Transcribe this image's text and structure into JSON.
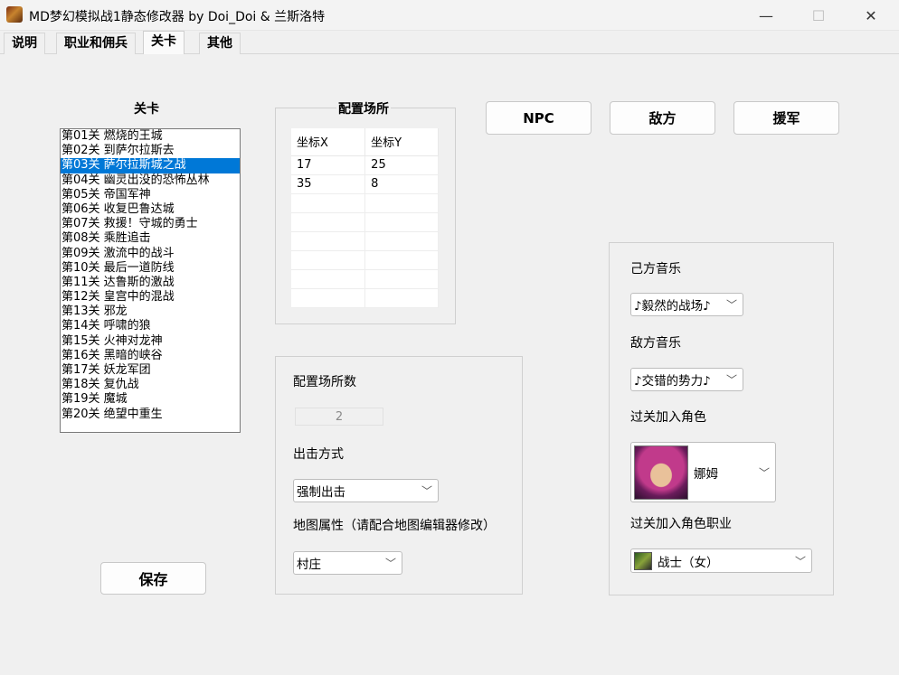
{
  "window": {
    "title": "MD梦幻模拟战1静态修改器 by Doi_Doi & 兰斯洛特",
    "icon": "game-character-icon",
    "controls": {
      "minimize": "—",
      "maximize": "☐",
      "close": "✕"
    }
  },
  "tabs": [
    {
      "label": "说明",
      "active": false
    },
    {
      "label": "职业和佣兵",
      "active": false
    },
    {
      "label": "关卡",
      "active": true
    },
    {
      "label": "其他",
      "active": false
    }
  ],
  "levels": {
    "heading": "关卡",
    "selected_index": 2,
    "items": [
      "第01关 燃烧的王城",
      "第02关 到萨尔拉斯去",
      "第03关 萨尔拉斯城之战",
      "第04关 幽灵出没的恐怖丛林",
      "第05关 帝国军神",
      "第06关 收复巴鲁达城",
      "第07关 救援！守城的勇士",
      "第08关 乘胜追击",
      "第09关 激流中的战斗",
      "第10关 最后一道防线",
      "第11关 达鲁斯的激战",
      "第12关 皇宫中的混战",
      "第13关 邪龙",
      "第14关 呼啸的狼",
      "第15关 火神对龙神",
      "第16关 黑暗的峡谷",
      "第17关 妖龙军团",
      "第18关 复仇战",
      "第19关 魔城",
      "第20关 绝望中重生"
    ]
  },
  "placement": {
    "heading": "配置场所",
    "columns": [
      "坐标X",
      "坐标Y"
    ],
    "rows": [
      [
        "17",
        "25"
      ],
      [
        "35",
        "8"
      ],
      [
        "",
        ""
      ],
      [
        "",
        ""
      ],
      [
        "",
        ""
      ],
      [
        "",
        ""
      ],
      [
        "",
        ""
      ],
      [
        "",
        ""
      ]
    ]
  },
  "buttons": {
    "npc": "NPC",
    "enemy": "敌方",
    "reinforce": "援军",
    "save": "保存"
  },
  "settings": {
    "count_label": "配置场所数",
    "count_value": "2",
    "sortie_label": "出击方式",
    "sortie_value": "强制出击",
    "map_attr_label": "地图属性（请配合地图编辑器修改）",
    "map_attr_value": "村庄"
  },
  "music": {
    "ally_label": "己方音乐",
    "ally_value": "♪毅然的战场♪",
    "enemy_label": "敌方音乐",
    "enemy_value": "♪交错的势力♪",
    "join_char_label": "过关加入角色",
    "join_char_value": "娜姆",
    "join_char_job_label": "过关加入角色职业",
    "join_char_job_value": "战士（女）"
  }
}
